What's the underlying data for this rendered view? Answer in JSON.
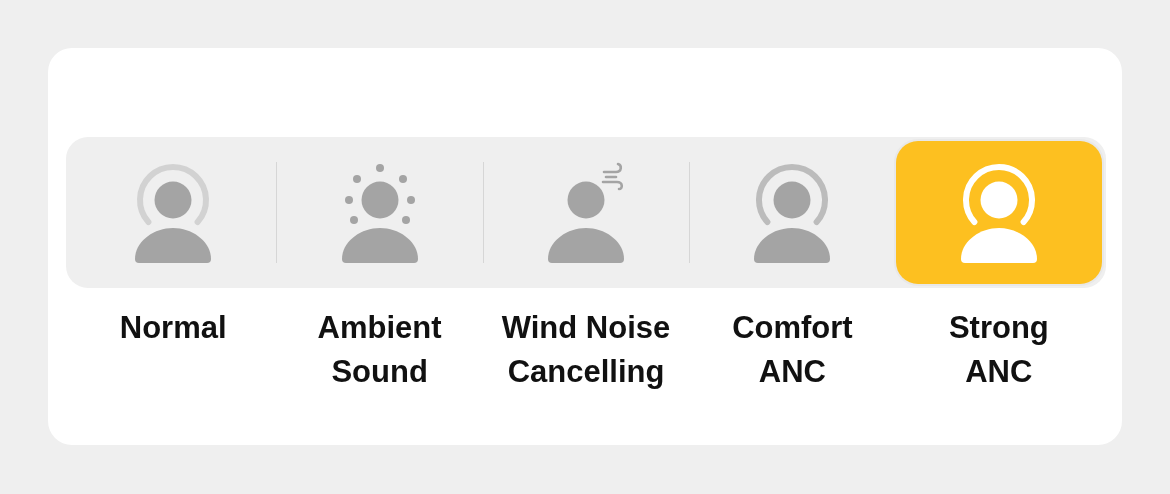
{
  "modes": [
    {
      "kind": "halo_light",
      "label_lines": [
        "Normal"
      ],
      "selected": false
    },
    {
      "kind": "dots",
      "label_lines": [
        "Ambient",
        "Sound"
      ],
      "selected": false
    },
    {
      "kind": "wind",
      "label_lines": [
        "Wind Noise",
        "Cancelling"
      ],
      "selected": false
    },
    {
      "kind": "halo",
      "label_lines": [
        "Comfort",
        "ANC"
      ],
      "selected": false
    },
    {
      "kind": "halo",
      "label_lines": [
        "Strong",
        "ANC"
      ],
      "selected": true
    }
  ]
}
